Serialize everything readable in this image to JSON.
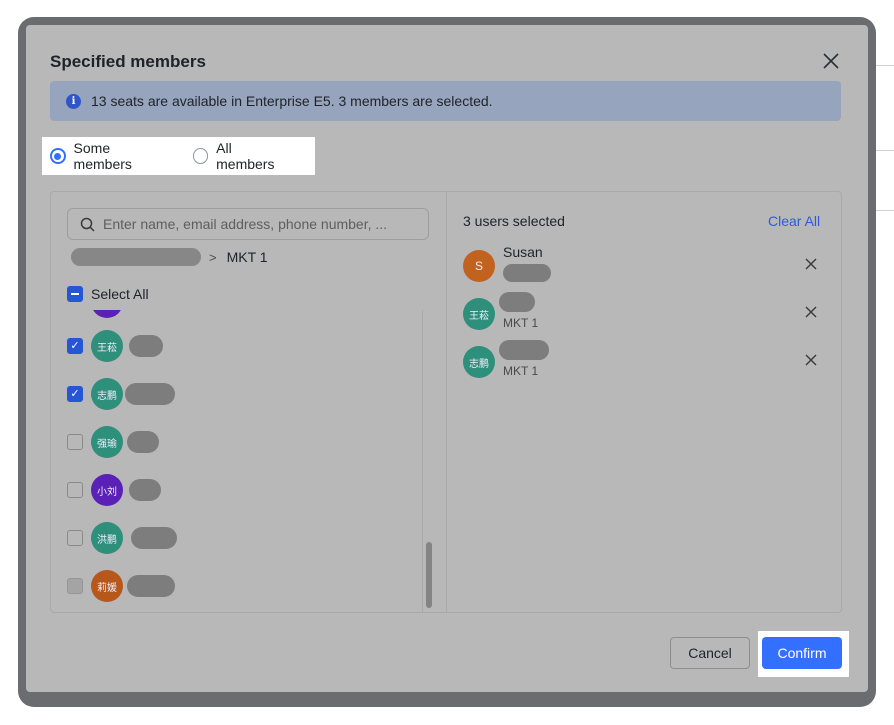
{
  "dialog": {
    "title": "Specified members",
    "notice": "13 seats are available in Enterprise E5. 3 members are selected."
  },
  "scope": {
    "options": [
      {
        "label": "Some members",
        "checked": true
      },
      {
        "label": "All members",
        "checked": false
      }
    ]
  },
  "left": {
    "search_placeholder": "Enter name, email address, phone number, ...",
    "breadcrumb_current": "MKT 1",
    "select_all_label": "Select All",
    "members": [
      {
        "avatar": "王菘",
        "color": "#2e8f7a",
        "checked": true
      },
      {
        "avatar": "志鹏",
        "color": "#2e8f7a",
        "checked": true
      },
      {
        "avatar": "强瑜",
        "color": "#2e8f7a",
        "checked": false
      },
      {
        "avatar": "小刘",
        "color": "#5b21b6",
        "checked": false
      },
      {
        "avatar": "洪鹏",
        "color": "#2e8f7a",
        "checked": false
      },
      {
        "avatar": "莉媛",
        "color": "#b6581b",
        "checked": false,
        "disabled": true
      }
    ]
  },
  "right": {
    "count_label": "3 users selected",
    "clear_all": "Clear All",
    "selected": [
      {
        "avatar": "S",
        "color": "#c2621f",
        "name": "Susan",
        "dept": ""
      },
      {
        "avatar": "王菘",
        "color": "#2e8f7a",
        "name": "",
        "dept": "MKT 1"
      },
      {
        "avatar": "志鹏",
        "color": "#2e8f7a",
        "name": "",
        "dept": "MKT 1"
      }
    ]
  },
  "footer": {
    "cancel": "Cancel",
    "confirm": "Confirm"
  },
  "icons": {
    "close": "close-icon",
    "info": "info-icon",
    "search": "search-icon",
    "remove": "remove-icon"
  }
}
